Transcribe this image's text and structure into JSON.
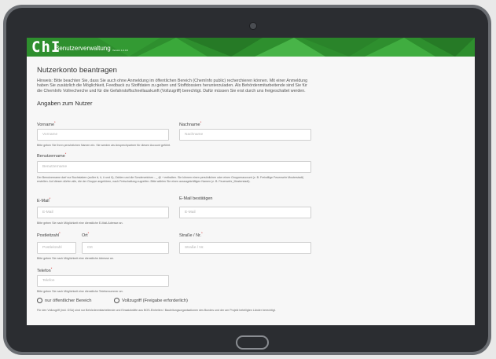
{
  "header": {
    "logo": "ChI",
    "title": "Benutzerverwaltung",
    "version": "Version 1.0.0.0"
  },
  "page": {
    "heading": "Nutzerkonto beantragen",
    "hint": "Hinweis: Bitte beachten Sie, dass Sie auch ohne Anmeldung im öffentlichen Bereich (ChemInfo public) recherchieren können. Mit einer Anmeldung haben Sie zusätzlich die Möglichkeit, Feedback zu Stoffdaten zu geben und Stoffdossiers herunterzuladen. Als Behördenmitarbeitende sind Sie für die ChemInfo Vollrecherche und für die Gefahrstoffschnellauskunft (Vollzugriff) berechtigt. Dafür müssen Sie erst durch uns freigeschaltet werden.",
    "section_title": "Angaben zum Nutzer"
  },
  "form": {
    "firstname": {
      "label": "Vorname",
      "placeholder": "Vorname"
    },
    "lastname": {
      "label": "Nachname",
      "placeholder": "Nachname"
    },
    "name_help": "Bitte geben Sie Ihren persönlichen Namen ein. Sie werden als Ansprechpartner für diesen Account geführt.",
    "username": {
      "label": "Benutzername",
      "placeholder": "Benutzername"
    },
    "username_help": "Der Benutzername darf nur Buchstaben (außer ä, ö, ü und ß), Zahlen und die Sonderzeichen - _ @ + enthalten. Sie können einen persönlichen oder einen Gruppenaccount (z. B. Freiwillige Feuerwehr Musterstadt) erstellen. Auf diesen dürfen alle, die der Gruppe angehören, nach Freischaltung zugreifen. Bitte wählen Sie einen aussagekräftigen Namen (z. B. Feuerwehr_Musterstadt).",
    "email": {
      "label": "E-Mail",
      "placeholder": "E-Mail"
    },
    "email_confirm": {
      "label": "E-Mail bestätigen",
      "placeholder": "E-Mail"
    },
    "email_help": "Bitte geben Sie nach Möglichkeit eine dienstliche E-Mail-Adresse an.",
    "zip": {
      "label": "Postleitzahl",
      "placeholder": "Postleitzahl"
    },
    "city": {
      "label": "Ort",
      "placeholder": "Ort"
    },
    "street": {
      "label": "Straße / Nr.",
      "placeholder": "Straße / Nr."
    },
    "address_help": "Bitte geben Sie nach Möglichkeit eine dienstliche Adresse an.",
    "phone": {
      "label": "Telefon",
      "placeholder": "Telefon"
    },
    "phone_help": "Bitte geben Sie nach Möglichkeit eine dienstliche Telefonnummer an.",
    "radio_public": "nur öffentlicher Bereich",
    "radio_full": "Vollzugriff (Freigabe erforderlich)",
    "access_help": "Für den Vollzugriff (inkl. GSA) sind nur Behördenmitarbeitende und Einsatzkräfte aus BOS-Einheiten / Bauleitungsorganisationen des Bundes und der am Projekt beteiligten Länder berechtigt."
  },
  "colors": {
    "banner": "#2e8f2e",
    "required": "#cc0000"
  }
}
